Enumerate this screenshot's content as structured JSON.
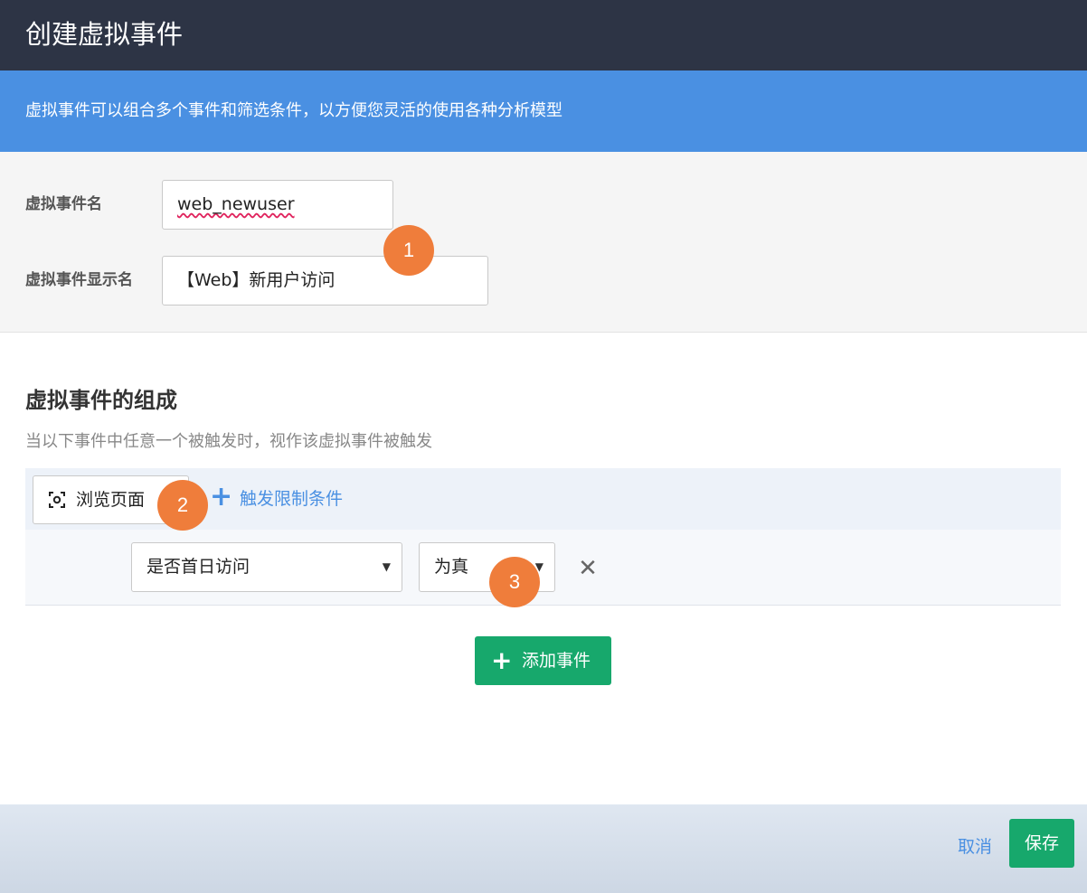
{
  "dialog": {
    "title": "创建虚拟事件"
  },
  "info": {
    "text": "虚拟事件可以组合多个事件和筛选条件，以方便您灵活的使用各种分析模型"
  },
  "form": {
    "name_label": "虚拟事件名",
    "name_value": "web_newuser",
    "display_label": "虚拟事件显示名",
    "display_value": "【Web】新用户访问"
  },
  "composition": {
    "title": "虚拟事件的组成",
    "description": "当以下事件中任意一个被触发时，视作该虚拟事件被触发",
    "event": {
      "icon": "scan-icon",
      "label": "浏览页面"
    },
    "add_condition": {
      "plus": "+",
      "label": "触发限制条件"
    },
    "condition": {
      "field": "是否首日访问",
      "operator": "为真",
      "remove": "✕"
    },
    "add_event": {
      "plus": "+",
      "label": "添加事件"
    }
  },
  "badges": [
    "1",
    "2",
    "3"
  ],
  "footer": {
    "cancel": "取消",
    "save": "保存"
  },
  "colors": {
    "titlebar": "#2d3445",
    "info": "#4a90e2",
    "primary_green": "#17a86c",
    "link_blue": "#4a90e2",
    "badge_orange": "#ef7d3b"
  }
}
